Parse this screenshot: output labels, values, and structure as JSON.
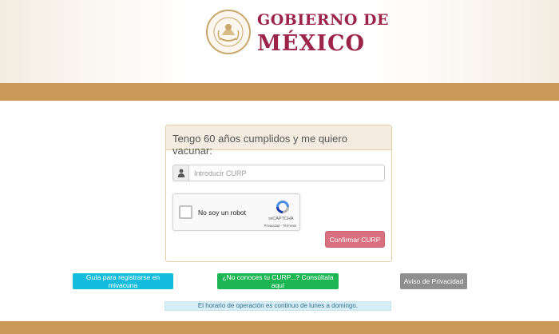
{
  "header": {
    "logo_line1": "GOBIERNO DE",
    "logo_line2": "MÉXICO",
    "seal_text": "ESTADOS UNIDOS MEXICANOS"
  },
  "card": {
    "title": "Tengo 60 años cumplidos y me quiero vacunar:",
    "curp_placeholder": "Introducir CURP",
    "curp_value": "",
    "user_icon": "user-icon",
    "recaptcha": {
      "label": "No soy un robot",
      "brand": "reCAPTCHA",
      "terms": "Privacidad - Términos",
      "checked": false
    },
    "confirm_label": "Confirmar CURP"
  },
  "links": {
    "guia_label": "Guía para registrarse en mivacuna",
    "curp_label": "¿No conoces tu CURP...? Consúltala aquí",
    "aviso_label": "Aviso de Privacidad"
  },
  "notice": "El horario de operación es continuo de lunes a domingo.",
  "colors": {
    "brand": "#9d2449",
    "band": "#c99a57",
    "confirm": "#d9707f",
    "guia": "#13bcdc",
    "curp": "#1bb653",
    "aviso": "#8f8f8f"
  }
}
